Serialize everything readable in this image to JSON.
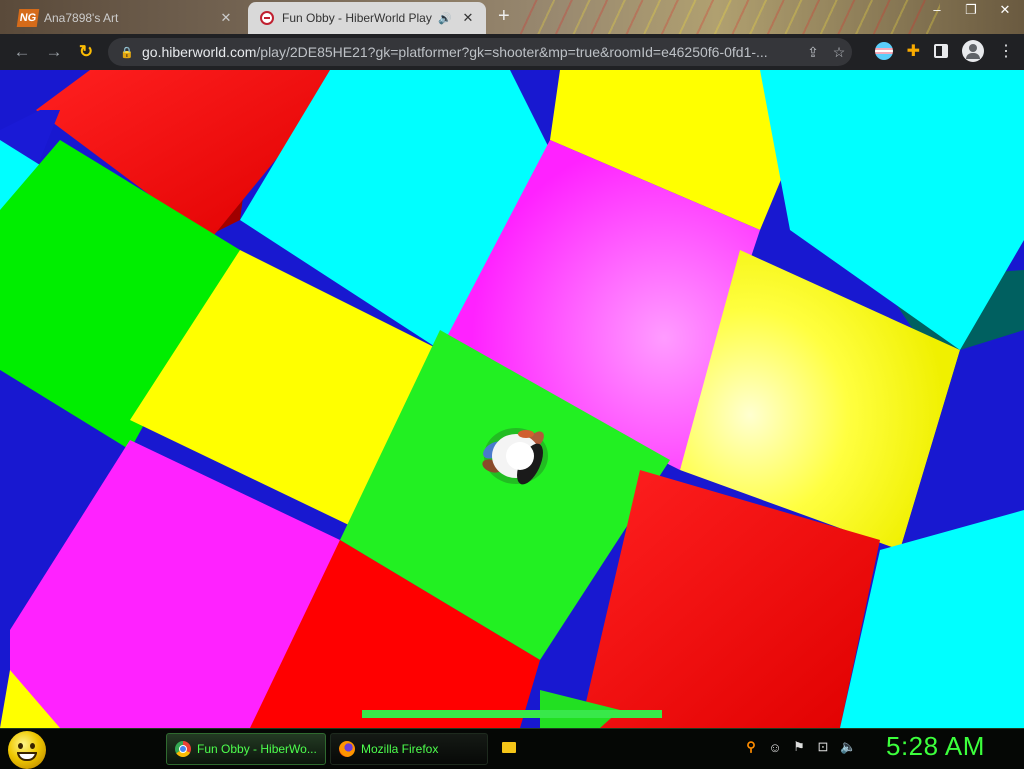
{
  "browser": {
    "tabs": [
      {
        "label": "Ana7898's Art",
        "active": false,
        "icon": "newgrounds-icon"
      },
      {
        "label": "Fun Obby - HiberWorld Play",
        "active": true,
        "icon": "hiberworld-icon",
        "audio": true
      }
    ],
    "new_tab_label": "+",
    "url_host": "go.hiberworld.com",
    "url_path": "/play/2DE85HE21?gk=platformer?gk=shooter&mp=true&roomId=e46250f6-0fd1-..."
  },
  "game": {
    "hud_bar_fraction": 1.0,
    "hud_bar_color": "#38e84a",
    "tile_colors": {
      "red": "#ff0000",
      "green": "#00e600",
      "yellow": "#ffff00",
      "cyan": "#00ffff",
      "magenta": "#ff22ff",
      "blue": "#1818d0"
    }
  },
  "taskbar": {
    "tasks": [
      {
        "label": "Fun Obby - HiberWo...",
        "icon": "chrome-icon",
        "active": true
      },
      {
        "label": "Mozilla Firefox",
        "icon": "firefox-icon",
        "active": false
      }
    ],
    "clock": "5:28 AM",
    "accent": "#3cff3c"
  }
}
